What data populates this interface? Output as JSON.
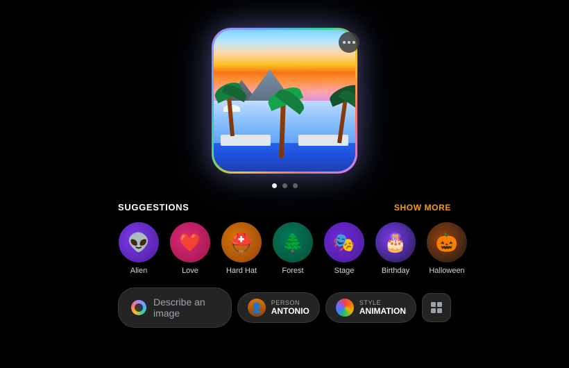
{
  "header": {
    "more_button_dots": "···"
  },
  "image": {
    "alt": "Tropical pool scene at sunset"
  },
  "pagination": {
    "total": 3,
    "active_index": 0
  },
  "suggestions": {
    "title": "SUGGESTIONS",
    "show_more": "SHOW MORE",
    "items": [
      {
        "id": "alien",
        "label": "Alien",
        "emoji": "👽",
        "icon_class": "icon-alien"
      },
      {
        "id": "love",
        "label": "Love",
        "emoji": "❤️",
        "icon_class": "icon-love"
      },
      {
        "id": "hardhat",
        "label": "Hard Hat",
        "emoji": "⛑️",
        "icon_class": "icon-hardhat"
      },
      {
        "id": "forest",
        "label": "Forest",
        "emoji": "🌲",
        "icon_class": "icon-forest"
      },
      {
        "id": "stage",
        "label": "Stage",
        "emoji": "🎭",
        "icon_class": "icon-stage"
      },
      {
        "id": "birthday",
        "label": "Birthday",
        "emoji": "🎂",
        "icon_class": "icon-birthday"
      },
      {
        "id": "halloween",
        "label": "Halloween",
        "emoji": "🎃",
        "icon_class": "icon-halloween"
      }
    ]
  },
  "toolbar": {
    "describe_placeholder": "Describe an image",
    "person_sublabel": "PERSON",
    "person_name": "ANTONIO",
    "style_sublabel": "STYLE",
    "style_name": "ANIMATION"
  }
}
